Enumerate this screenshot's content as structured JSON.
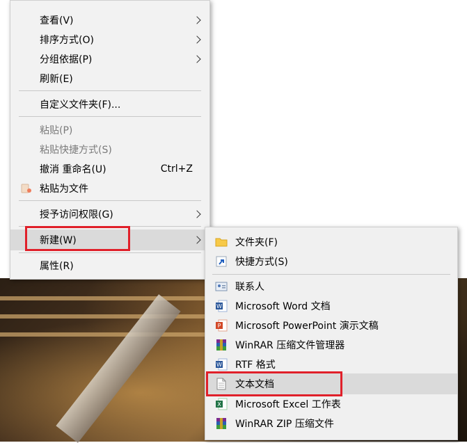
{
  "main_menu": {
    "items": [
      {
        "label": "查看(V)"
      },
      {
        "label": "排序方式(O)"
      },
      {
        "label": "分组依据(P)"
      },
      {
        "label": "刷新(E)"
      },
      {
        "label": "自定义文件夹(F)..."
      },
      {
        "label": "粘贴(P)"
      },
      {
        "label": "粘贴快捷方式(S)"
      },
      {
        "label": "撤消 重命名(U)",
        "shortcut": "Ctrl+Z"
      },
      {
        "label": "粘贴为文件"
      },
      {
        "label": "授予访问权限(G)"
      },
      {
        "label": "新建(W)"
      },
      {
        "label": "属性(R)"
      }
    ]
  },
  "new_submenu": {
    "items": [
      {
        "label": "文件夹(F)",
        "icon": "folder-icon"
      },
      {
        "label": "快捷方式(S)",
        "icon": "shortcut-icon"
      },
      {
        "label": "联系人",
        "icon": "contact-icon"
      },
      {
        "label": "Microsoft Word 文档",
        "icon": "word-icon"
      },
      {
        "label": "Microsoft PowerPoint 演示文稿",
        "icon": "powerpoint-icon"
      },
      {
        "label": "WinRAR 压缩文件管理器",
        "icon": "winrar-icon"
      },
      {
        "label": "RTF 格式",
        "icon": "rtf-icon"
      },
      {
        "label": "文本文档",
        "icon": "text-document-icon"
      },
      {
        "label": "Microsoft Excel 工作表",
        "icon": "excel-icon"
      },
      {
        "label": "WinRAR ZIP 压缩文件",
        "icon": "winrar-zip-icon"
      }
    ]
  },
  "colors": {
    "highlight_box": "#e0202a",
    "menu_background": "#f2f2f2",
    "hover_background": "#dadada"
  }
}
